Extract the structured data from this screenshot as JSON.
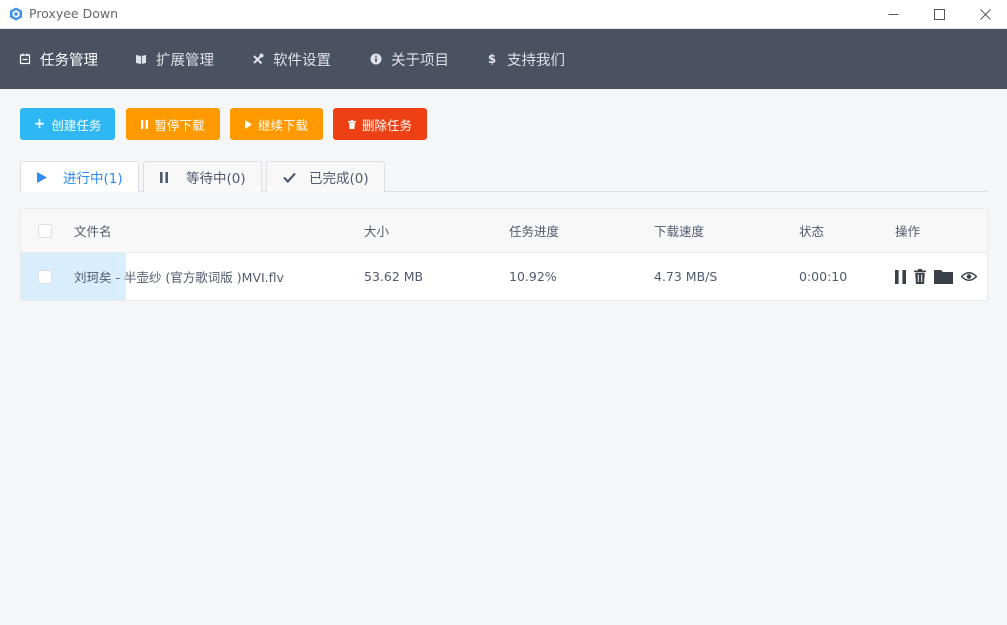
{
  "window": {
    "title": "Proxyee Down",
    "minimize": "—",
    "maximize": "☐",
    "close": "✕"
  },
  "nav": {
    "items": [
      {
        "label": "任务管理",
        "icon": "task-icon",
        "active": true
      },
      {
        "label": "扩展管理",
        "icon": "book-icon",
        "active": false
      },
      {
        "label": "软件设置",
        "icon": "tools-icon",
        "active": false
      },
      {
        "label": "关于项目",
        "icon": "info-icon",
        "active": false
      },
      {
        "label": "支持我们",
        "icon": "dollar-icon",
        "active": false
      }
    ]
  },
  "toolbar": {
    "create_label": "创建任务",
    "pause_label": "暂停下载",
    "resume_label": "继续下载",
    "delete_label": "删除任务",
    "colors": {
      "create": "#2db7f5",
      "pause": "#ff9900",
      "resume": "#ff9900",
      "delete": "#ed4014"
    }
  },
  "tabs": [
    {
      "label": "进行中(1)",
      "icon": "play-icon",
      "active": true
    },
    {
      "label": "等待中(0)",
      "icon": "pause-icon",
      "active": false
    },
    {
      "label": "已完成(0)",
      "icon": "check-icon",
      "active": false
    }
  ],
  "table": {
    "headers": {
      "name": "文件名",
      "size": "大小",
      "progress": "任务进度",
      "speed": "下载速度",
      "status": "状态",
      "actions": "操作"
    },
    "rows": [
      {
        "name": "刘珂矣 - 半壶纱 (官方歌词版 )MVI.flv",
        "size": "53.62 MB",
        "progress": "10.92%",
        "progress_value": 0.1092,
        "speed": "4.73 MB/S",
        "status": "0:00:10",
        "actions": [
          "pause-icon",
          "trash-icon",
          "folder-icon",
          "eye-icon"
        ]
      }
    ]
  }
}
